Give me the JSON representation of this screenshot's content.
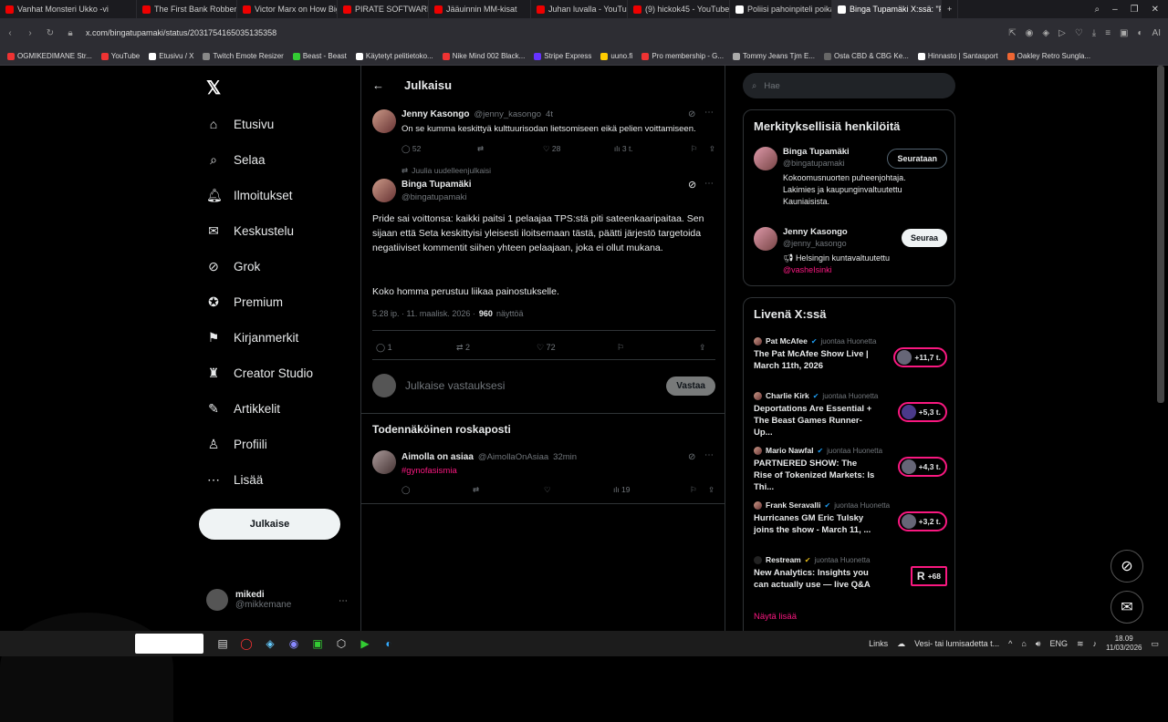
{
  "browser": {
    "tabs": [
      "Vanhat Monsteri Ukko -vi",
      "The First Bank Robber to",
      "Victor Marx on How Big T",
      "PIRATE SOFTWARE TRIED",
      "Jääuinnin MM-kisat",
      "Juhan luvalla - YouTube",
      "(9) hickok45 - YouTube",
      "Poliisi pahoinpiteli poikan",
      "Binga Tupamäki X:ssä: \"P"
    ],
    "url": "x.com/bingatupamaki/status/2031754165035135358",
    "bookmarks": [
      "OGMIKEDIMANE Str...",
      "YouTube",
      "Etusivu / X",
      "Twitch Emote Resizer",
      "Beast - Beast",
      "Käytetyt pelitietoko...",
      "Nike Mind 002 Black...",
      "Stripe Express",
      "uuno.fi",
      "Pro membership - G...",
      "Tommy Jeans Tjm E...",
      "Osta CBD & CBG Ke...",
      "Hinnasto | Santasport",
      "Oakley Retro Sunglа..."
    ]
  },
  "nav": {
    "items": [
      "Etusivu",
      "Selaa",
      "Ilmoitukset",
      "Keskustelu",
      "Grok",
      "Premium",
      "Kirjanmerkit",
      "Creator Studio",
      "Artikkelit",
      "Profiili",
      "Lisää"
    ],
    "post_button": "Julkaise",
    "me_name": "mikedi",
    "me_handle": "@mikkemane"
  },
  "header": {
    "title": "Julkaisu"
  },
  "tweet1": {
    "name": "Jenny Kasongo",
    "handle": "@jenny_kasongo",
    "time": "4t",
    "text": "On se kumma keskittyä kulttuurisodan lietsomiseen eikä pelien voittamiseen.",
    "replies": "52",
    "likes": "28",
    "views": "3 t."
  },
  "repost_note": "Juulia uudelleenjulkaisi",
  "main": {
    "name": "Binga Tupamäki",
    "handle": "@bingatupamaki",
    "para1": "Pride sai voittonsa: kaikki paitsi 1 pelaajaa TPS:stä piti sateenkaaripaitaa. Sen sijaan että Seta keskittyisi yleisesti iloitsemaan tästä, päätti järjestö targetoida negatiiviset kommentit siihen yhteen pelaajaan, joka ei ollut mukana.",
    "para2": "Koko homma perustuu liikaa painostukselle.",
    "meta": "5.28 ip. · 11. maalisk. 2026 ·",
    "views": "960",
    "views_label": "näyttöä",
    "replies": "1",
    "reposts": "2",
    "likes": "72"
  },
  "reply": {
    "placeholder": "Julkaise vastauksesi",
    "button": "Vastaa"
  },
  "spam": {
    "title": "Todennäköinen roskaposti",
    "name": "Aimolla on asiaa",
    "handle": "@AimollaOnAsiaa",
    "time": "32min",
    "text": "#gynofasismia",
    "views": "19"
  },
  "right": {
    "search_placeholder": "Hae",
    "relevant_title": "Merkityksellisiä henkilöitä",
    "p1": {
      "name": "Binga Tupamäki",
      "handle": "@bingatupamaki",
      "bio": "Kokoomusnuorten puheenjohtaja. Lakimies ja kaupunginvaltuutettu Kauniaisista.",
      "button": "Seurataan"
    },
    "p2": {
      "name": "Jenny Kasongo",
      "handle": "@jenny_kasongo",
      "bio": "Helsingin kuntavaltuutettu",
      "link": "@vasheIsinki",
      "button": "Seuraa"
    },
    "live_title": "Livenä X:ssä",
    "live": [
      {
        "host": "Pat McAfee",
        "tag": "juontaa Huonetta",
        "title": "The Pat McAfee Show Live | March 11th, 2026",
        "count": "+11,7 t."
      },
      {
        "host": "Charlie Kirk",
        "tag": "juontaa Huonetta",
        "title": "Deportations Are Essential + The Beast Games Runner-Up...",
        "count": "+5,3 t."
      },
      {
        "host": "Mario Nawfal",
        "tag": "juontaa Huonetta",
        "title": "PARTNERED SHOW: The Rise of Tokenized Markets: Is Thi...",
        "count": "+4,3 t."
      },
      {
        "host": "Frank Seravalli",
        "tag": "juontaa Huonetta",
        "title": "Hurricanes GM Eric Tulsky joins the show - March 11, ...",
        "count": "+3,2 t."
      },
      {
        "host": "Restream",
        "tag": "juontaa Huonetta",
        "title": "New Analytics: Insights you can actually use — live Q&A",
        "count": "+68"
      }
    ],
    "show_more": "Näytä lisää"
  },
  "taskbar": {
    "links": "Links",
    "weather": "Vesi- tai lumisadetta t...",
    "lang": "ENG",
    "time": "18.09",
    "date": "11/03/2026"
  }
}
